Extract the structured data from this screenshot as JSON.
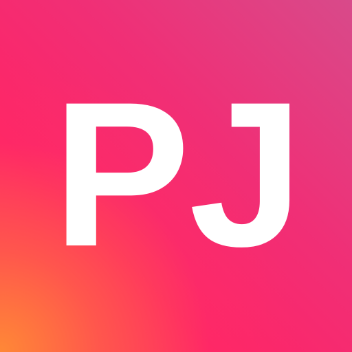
{
  "app_icon": {
    "monogram": "PJ",
    "colors": {
      "text": "#ffffff",
      "gradient_top_right": "#d84a8a",
      "gradient_center": "#ff2466",
      "gradient_bottom_left": "#ff8836"
    }
  }
}
